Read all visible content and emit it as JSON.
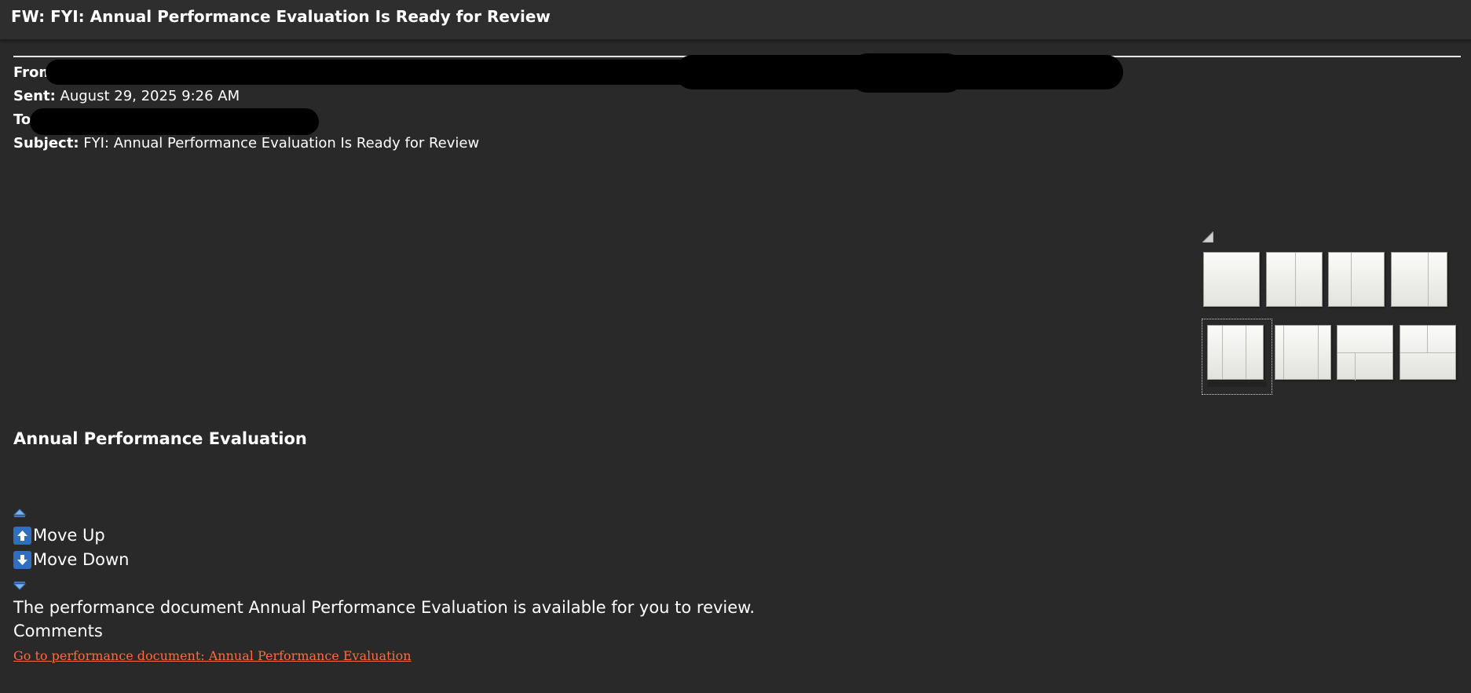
{
  "window": {
    "title": "FW: FYI: Annual Performance Evaluation Is Ready for Review"
  },
  "header": {
    "from_label": "From",
    "sent_label": "Sent:",
    "sent_value": "August 29, 2025 9:26 AM",
    "to_label": "To",
    "subject_label": "Subject:",
    "subject_value": "FYI: Annual Performance Evaluation Is Ready for Review"
  },
  "layouts": [
    {
      "name": "layout-one-column"
    },
    {
      "name": "layout-two-columns-right-narrow"
    },
    {
      "name": "layout-two-columns-left-narrow"
    },
    {
      "name": "layout-two-columns-right-narrow-alt"
    },
    {
      "name": "layout-three-columns",
      "selected": true
    },
    {
      "name": "layout-two-columns-wide-center"
    },
    {
      "name": "layout-header-two-columns"
    },
    {
      "name": "layout-two-columns-footer"
    }
  ],
  "content": {
    "section_title": "Annual Performance Evaluation",
    "move_up": "Move Up",
    "move_down": "Move Down",
    "message": "The performance document Annual Performance Evaluation is available for you to review.",
    "comments": "Comments",
    "link_text": "Go to performance document: Annual Performance Evaluation"
  },
  "colors": {
    "background": "#292929",
    "link": "#ff6a3d",
    "icon_blue": "#2f6fc2"
  }
}
